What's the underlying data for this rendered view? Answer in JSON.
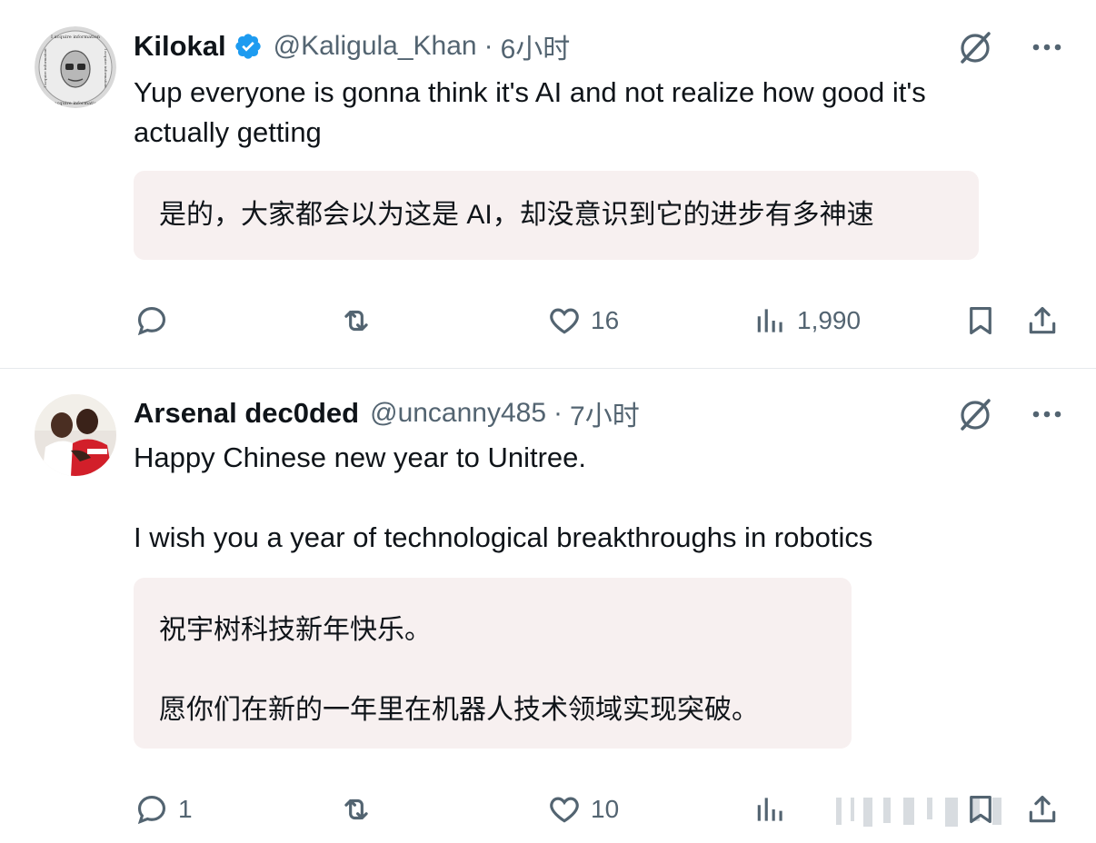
{
  "tweets": [
    {
      "display_name": "Kilokal",
      "verified": true,
      "handle": "@Kaligula_Khan",
      "separator": "·",
      "time": "6小时",
      "avatar_text_top": "I acquire information",
      "avatar_text_left": "I acquire information",
      "avatar_text_right": "I acquire information",
      "avatar_text_bottom": "I acquire information",
      "text_lines": [
        "Yup everyone is gonna think it's AI and not realize how good it's",
        "actually getting"
      ],
      "translation_lines": [
        "是的，大家都会以为这是 AI，却没意识到它的进步有多神速"
      ],
      "actions": {
        "reply": "",
        "repost": "",
        "like": "16",
        "views": "1,990"
      }
    },
    {
      "display_name": "Arsenal dec0ded",
      "verified": false,
      "handle": "@uncanny485",
      "separator": "·",
      "time": "7小时",
      "text_lines": [
        "Happy Chinese new year to Unitree.",
        "",
        "I wish you a year of technological breakthroughs in robotics"
      ],
      "translation_lines": [
        "祝宇树科技新年快乐。",
        "",
        "愿你们在新的一年里在机器人技术领域实现突破。"
      ],
      "actions": {
        "reply": "1",
        "repost": "",
        "like": "10",
        "views": ""
      }
    }
  ],
  "icons": {
    "reply": "reply-icon",
    "repost": "repost-icon",
    "like": "heart-icon",
    "views": "views-icon",
    "bookmark": "bookmark-icon",
    "share": "share-icon",
    "grok": "grok-icon",
    "more": "more-icon",
    "verified": "verified-badge-icon"
  },
  "colors": {
    "text": "#0f1419",
    "muted": "#536471",
    "verified": "#1d9bf0",
    "translation_bg": "#f7f0f0"
  }
}
